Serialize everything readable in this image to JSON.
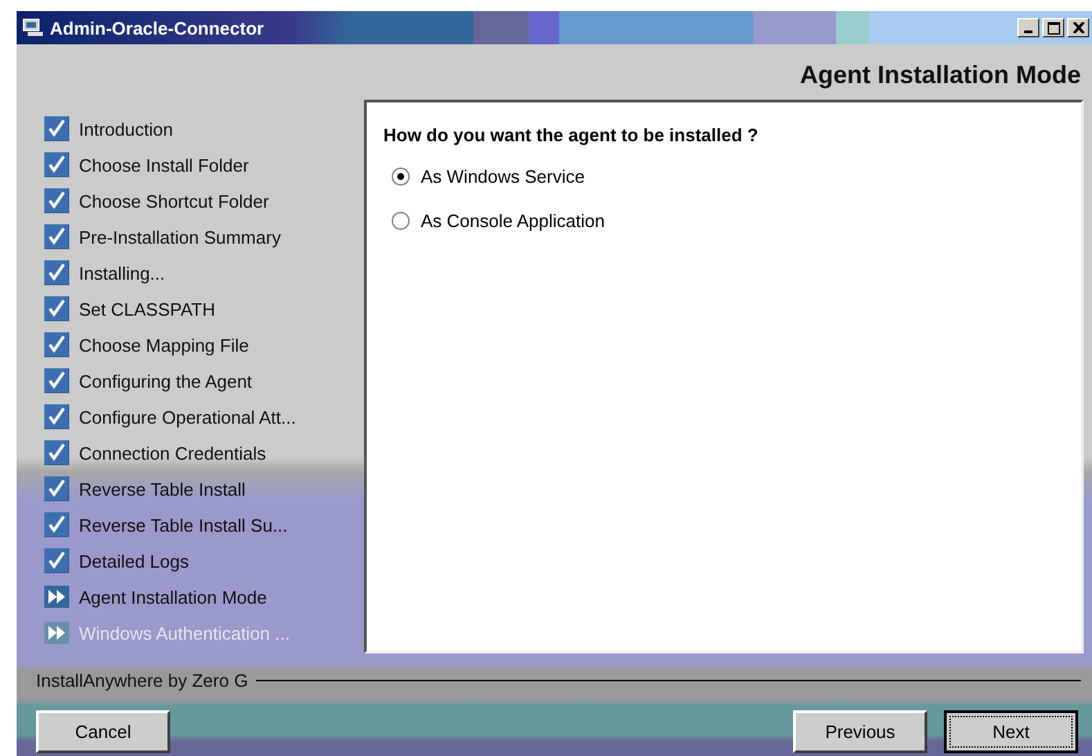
{
  "window": {
    "title": "Admin-Oracle-Connector"
  },
  "header": {
    "title": "Agent Installation Mode"
  },
  "steps": [
    {
      "label": "Introduction",
      "kind": "done"
    },
    {
      "label": "Choose Install Folder",
      "kind": "done"
    },
    {
      "label": "Choose Shortcut Folder",
      "kind": "done"
    },
    {
      "label": "Pre-Installation Summary",
      "kind": "done"
    },
    {
      "label": "Installing...",
      "kind": "done"
    },
    {
      "label": "Set CLASSPATH",
      "kind": "done"
    },
    {
      "label": "Choose Mapping File",
      "kind": "done"
    },
    {
      "label": "Configuring the Agent",
      "kind": "done"
    },
    {
      "label": "Configure Operational Att...",
      "kind": "done"
    },
    {
      "label": "Connection Credentials",
      "kind": "done"
    },
    {
      "label": "Reverse Table Install",
      "kind": "done"
    },
    {
      "label": "Reverse Table Install Su...",
      "kind": "done"
    },
    {
      "label": "Detailed Logs",
      "kind": "done"
    },
    {
      "label": "Agent Installation Mode",
      "kind": "current"
    },
    {
      "label": "Windows Authentication ...",
      "kind": "pending"
    }
  ],
  "question": "How do you want the agent to be installed ?",
  "options": [
    {
      "label": "As Windows Service",
      "selected": true
    },
    {
      "label": "As Console Application",
      "selected": false
    }
  ],
  "footer": {
    "brand": "InstallAnywhere by Zero G"
  },
  "buttons": {
    "cancel": "Cancel",
    "previous": "Previous",
    "next": "Next"
  }
}
